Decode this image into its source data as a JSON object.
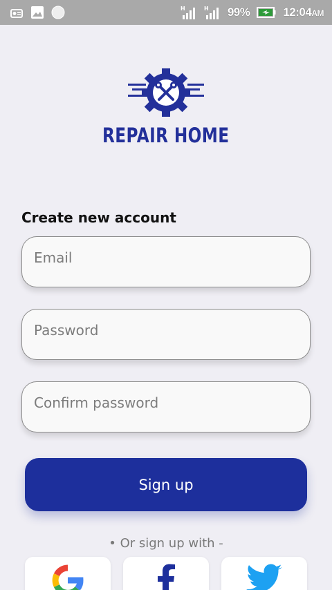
{
  "status_bar": {
    "battery": "99%",
    "time": "12:04",
    "ampm": "AM",
    "icons": [
      "radio-icon",
      "image-icon",
      "sync-icon",
      "signal-h-icon",
      "signal-h-icon",
      "battery-charging-icon"
    ]
  },
  "brand": {
    "name": "REPAIR HOME",
    "color": "#23309a"
  },
  "form": {
    "heading": "Create new account",
    "email_placeholder": "Email",
    "password_placeholder": "Password",
    "confirm_placeholder": "Confirm password",
    "signup_label": "Sign up"
  },
  "social": {
    "divider": "• Or sign up with -",
    "providers": [
      "google-icon",
      "facebook-icon",
      "twitter-icon"
    ]
  },
  "colors": {
    "accent": "#1d2f9c",
    "background": "#efeef4",
    "status_bar": "#a9a9a9"
  }
}
